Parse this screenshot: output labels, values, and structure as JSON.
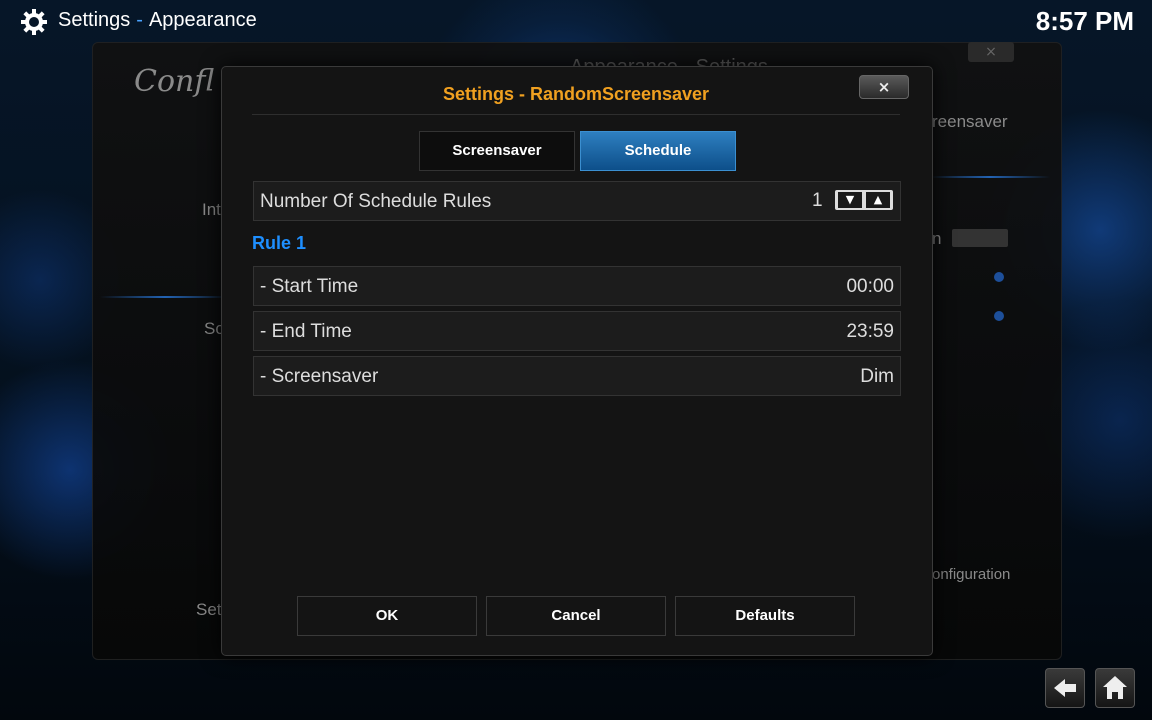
{
  "topbar": {
    "section": "Settings",
    "separator": "-",
    "page": "Appearance",
    "time": "8:57 PM"
  },
  "background_dialog": {
    "logo": "Confl",
    "title": "Appearance - Settings",
    "close": "×",
    "item_1": "Int",
    "item_2": "Sc",
    "item_3": "Set",
    "right_1": "reensaver",
    "right_2": "n",
    "right_3": "onfiguration"
  },
  "dialog": {
    "title": "Settings - RandomScreensaver",
    "close": "×",
    "tabs": [
      {
        "label": "Screensaver",
        "active": false
      },
      {
        "label": "Schedule",
        "active": true
      }
    ],
    "rule_count_label": "Number Of Schedule Rules",
    "rule_count_value": "1",
    "section_title": "Rule 1",
    "rows": [
      {
        "label": "- Start Time",
        "value": "00:00"
      },
      {
        "label": "- End Time",
        "value": "23:59"
      },
      {
        "label": "- Screensaver",
        "value": "Dim"
      }
    ],
    "buttons": {
      "ok": "OK",
      "cancel": "Cancel",
      "defaults": "Defaults"
    }
  },
  "colors": {
    "accent_orange": "#f0a020",
    "accent_blue": "#1e8fff",
    "tab_active": "#1a6aa8"
  },
  "icons": [
    "gear-icon",
    "close-icon",
    "arrow-down-icon",
    "arrow-up-icon",
    "back-arrow-icon",
    "home-icon"
  ]
}
